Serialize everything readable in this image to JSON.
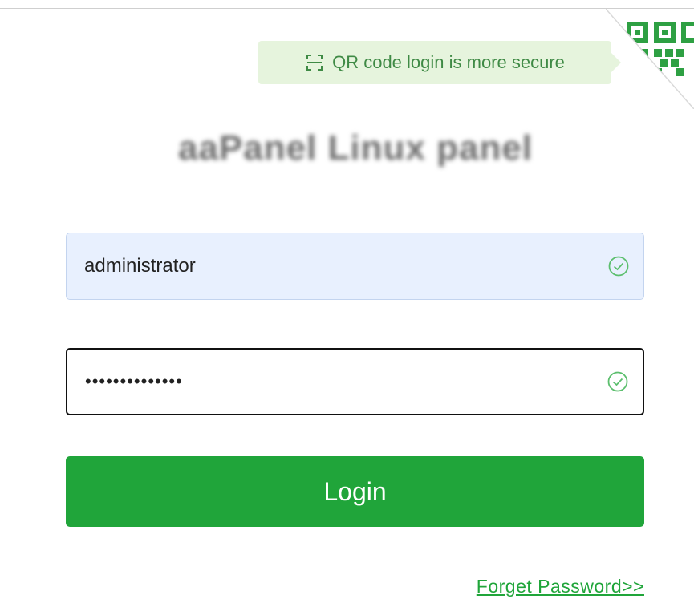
{
  "qr_tip": {
    "text": "QR code login is more secure",
    "icon": "scan-icon"
  },
  "panel": {
    "title": "aaPanel Linux panel"
  },
  "form": {
    "username": {
      "value": "administrator",
      "status_icon": "check-circle-icon"
    },
    "password": {
      "value": "••••••••••••••",
      "status_icon": "check-circle-icon"
    },
    "login_label": "Login",
    "forget_label": "Forget Password>>"
  },
  "colors": {
    "brand_green": "#20a53a",
    "tip_background": "#e6f4dd",
    "autofill_background": "#e8f0fe"
  }
}
